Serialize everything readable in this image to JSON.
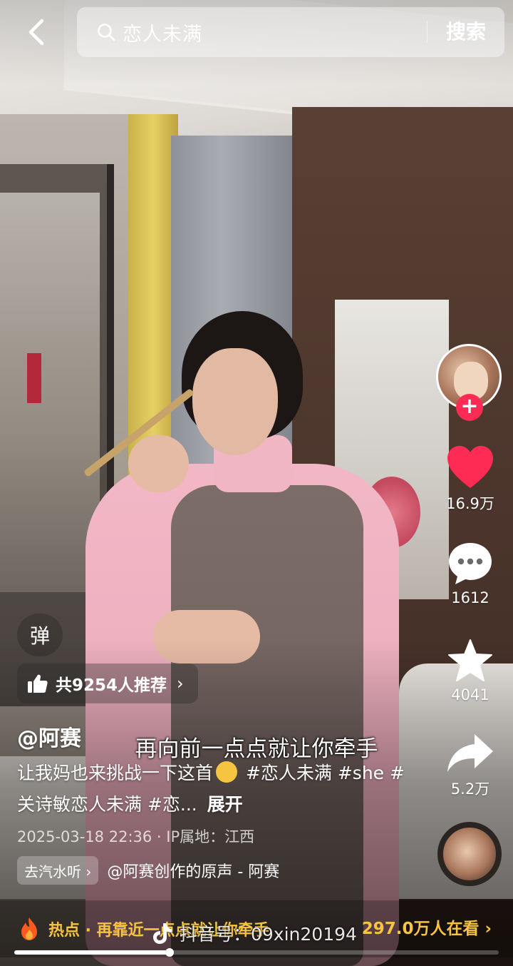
{
  "search": {
    "query": "恋人未满",
    "button_label": "搜索"
  },
  "creator": {
    "follow_symbol": "+"
  },
  "actions": {
    "likes": "16.9万",
    "comments": "1612",
    "favorites": "4041",
    "shares": "5.2万"
  },
  "danmu": {
    "label": "弹"
  },
  "recommend": {
    "label": "共9254人推荐",
    "chevron": "›"
  },
  "video": {
    "author": "@阿赛",
    "caption": "再向前一点点就让你牵手",
    "description_lead": "让我妈也来挑战一下这首",
    "description_tail": " #恋人未满 #she #关诗敏恋人未满 #恋...",
    "expand_label": "展开",
    "meta": "2025-03-18 22:36 · IP属地：江西"
  },
  "music": {
    "qishui_label": "去汽水听 ›",
    "title": "@阿赛创作的原声 - 阿赛"
  },
  "hot": {
    "label": "热点 · 再靠近一点点就让你牵手",
    "watchers": "297.0万人在看 ›"
  },
  "watermark": {
    "text": "抖音号：09xin20194"
  },
  "playback": {
    "progress": 0.32
  },
  "colors": {
    "like": "#fe2c55",
    "hot": "#f6c342",
    "follow": "#fe2c55"
  },
  "icons": [
    "back-arrow-icon",
    "search-icon",
    "heart-icon",
    "comment-icon",
    "star-icon",
    "share-icon",
    "thumbs-up-icon",
    "fire-icon",
    "douyin-logo-icon"
  ]
}
